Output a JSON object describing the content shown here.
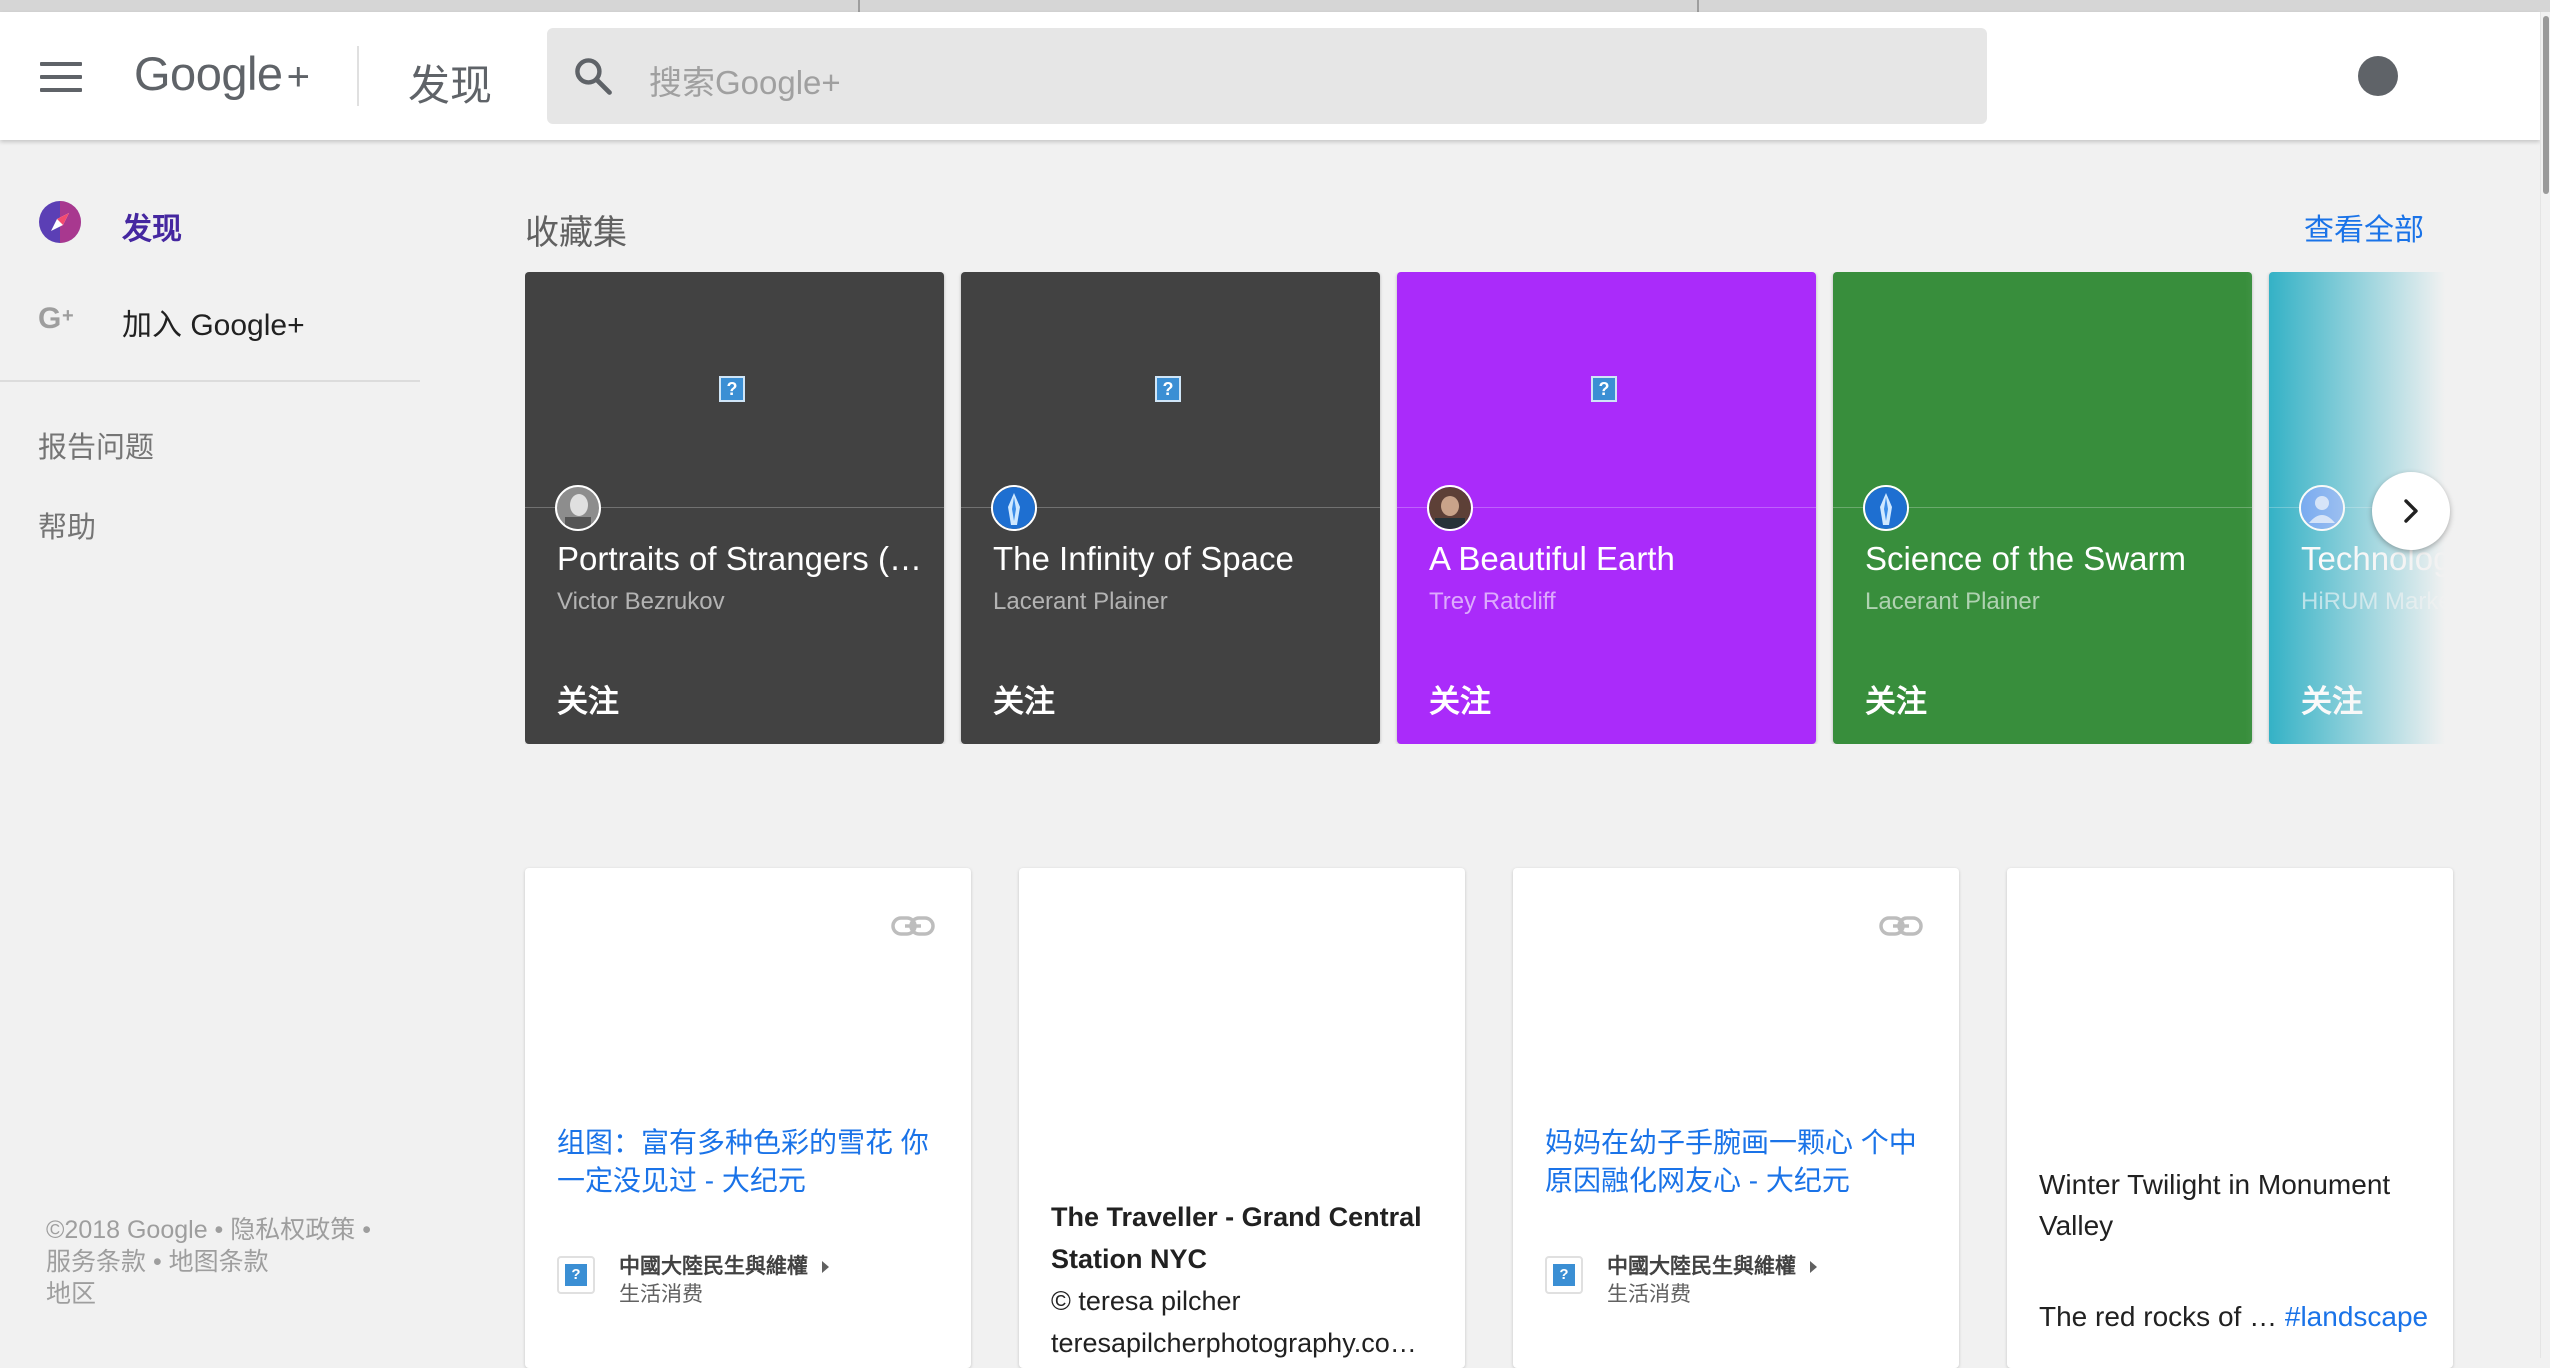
{
  "header": {
    "logo_text": "Google",
    "logo_plus": "+",
    "page_title": "发现",
    "search_placeholder": "搜索Google+"
  },
  "sidebar": {
    "items": [
      {
        "label": "发现",
        "icon": "compass-icon",
        "active": true
      },
      {
        "label": "加入 Google+",
        "icon": "google-plus-icon",
        "active": false
      }
    ],
    "links": [
      "报告问题",
      "帮助"
    ],
    "footer": {
      "copyright": "©2018 Google",
      "privacy": "隐私权政策",
      "terms": "服务条款",
      "map_terms": "地图条款",
      "region": "地区"
    }
  },
  "collections": {
    "section_title": "收藏集",
    "view_all": "查看全部",
    "items": [
      {
        "title": "Portraits of Strangers (…",
        "owner": "Victor Bezrukov",
        "follow": "关注",
        "color": "#424242",
        "avatar": "photo"
      },
      {
        "title": "The Infinity of Space",
        "owner": "Lacerant Plainer",
        "follow": "关注",
        "color": "#424242",
        "avatar": "blue-figure"
      },
      {
        "title": "A Beautiful Earth",
        "owner": "Trey Ratcliff",
        "follow": "关注",
        "color": "#aa2bfa",
        "avatar": "photo"
      },
      {
        "title": "Science of the Swarm",
        "owner": "Lacerant Plainer",
        "follow": "关注",
        "color": "#388e3c",
        "avatar": "blue-figure"
      },
      {
        "title": "Technology",
        "owner": "HiRUM Marketing",
        "follow": "关注",
        "color": "#1aa9c0",
        "avatar": "default-person"
      }
    ]
  },
  "posts": [
    {
      "type": "link",
      "title": "组图：富有多种色彩的雪花 你一定没见过 - 大纪元",
      "source": "中國大陸民生與維權",
      "source_sub": "生活消费"
    },
    {
      "type": "photo",
      "title": "The Traveller - Grand Central Station NYC",
      "credit": "© teresa pilcher",
      "credit_url": "teresapilcherphotography.co…"
    },
    {
      "type": "link",
      "title": "妈妈在幼子手腕画一颗心 个中原因融化网友心 - 大纪元",
      "source": "中國大陸民生與維權",
      "source_sub": "生活消费"
    },
    {
      "type": "text",
      "title": "Winter Twilight in Monument Valley",
      "body": "The red rocks of …",
      "hashtag": "#landscape"
    }
  ]
}
